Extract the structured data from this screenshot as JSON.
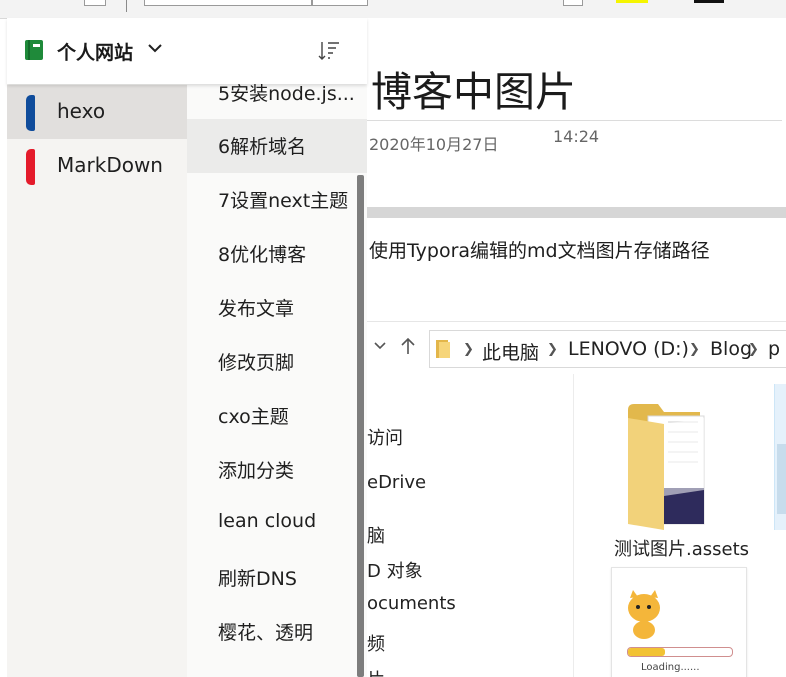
{
  "notebook": {
    "title": "个人网站",
    "sections": [
      {
        "label": "hexo",
        "color": "#0f4c9b",
        "selected": true
      },
      {
        "label": "MarkDown",
        "color": "#e41b2b",
        "selected": false
      }
    ]
  },
  "pages": [
    {
      "label": "5安装node.js..."
    },
    {
      "label": "6解析域名",
      "selected": true
    },
    {
      "label": "7设置next主题"
    },
    {
      "label": "8优化博客"
    },
    {
      "label": "发布文章"
    },
    {
      "label": "修改页脚"
    },
    {
      "label": "cxo主题"
    },
    {
      "label": "添加分类"
    },
    {
      "label": "lean cloud"
    },
    {
      "label": "刷新DNS"
    },
    {
      "label": "樱花、透明"
    }
  ],
  "document": {
    "title": "博客中图片",
    "date": "2020年10月27日",
    "time": "14:24",
    "body_text": "使用Typora编辑的md文档图片存储路径"
  },
  "explorer": {
    "breadcrumbs": [
      "此电脑",
      "LENOVO (D:)",
      "Blog",
      "p"
    ],
    "nav_items": [
      "访问",
      "eDrive",
      "脑",
      "D 对象",
      "ocuments",
      "频",
      "片"
    ],
    "folder_label": "测试图片.assets",
    "thumbnail_text": "Loading......",
    "thumbnail_progress": 0.36
  }
}
